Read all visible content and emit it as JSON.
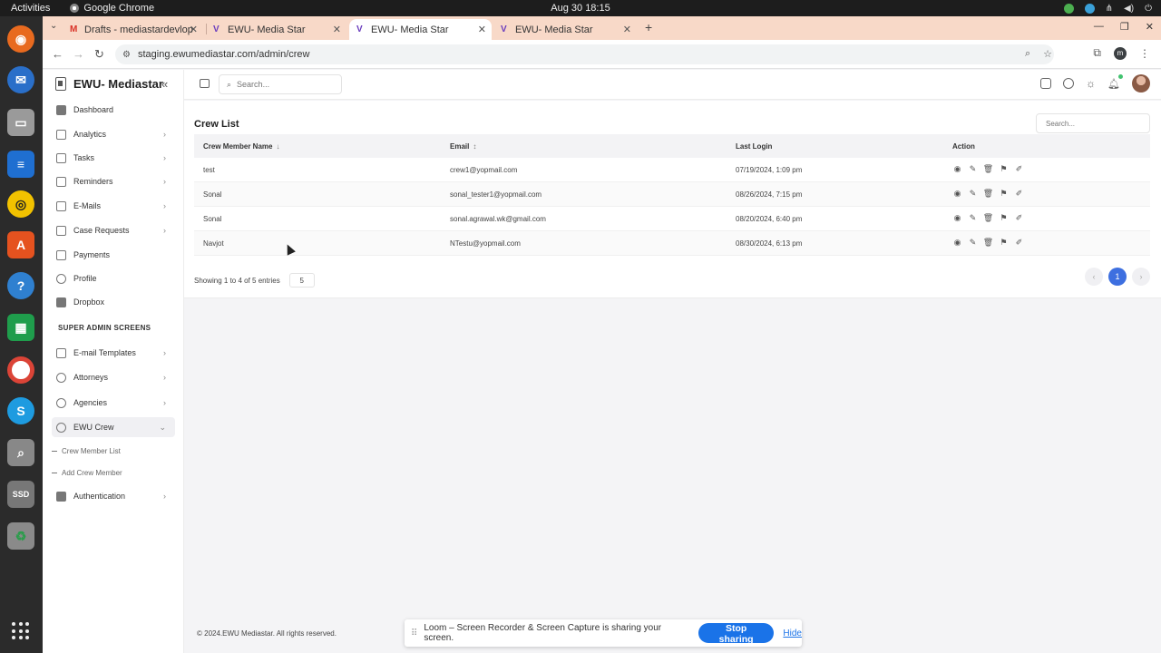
{
  "os": {
    "activities": "Activities",
    "app_name": "Google Chrome",
    "clock": "Aug 30  18:15"
  },
  "browser": {
    "tabs": [
      {
        "label": "Drafts - mediastardevlop",
        "favicon": "gmail-icon"
      },
      {
        "label": "EWU- Media Star",
        "favicon": "vite-icon"
      },
      {
        "label": "EWU- Media Star",
        "favicon": "vite-icon"
      },
      {
        "label": "EWU- Media Star",
        "favicon": "vite-icon"
      }
    ],
    "active_tab": 2,
    "url": "staging.ewumediastar.com/admin/crew",
    "profile_initial": "m"
  },
  "sidebar": {
    "brand": "EWU- Mediastar",
    "items": [
      {
        "label": "Dashboard"
      },
      {
        "label": "Analytics"
      },
      {
        "label": "Tasks"
      },
      {
        "label": "Reminders"
      },
      {
        "label": "E-Mails"
      },
      {
        "label": "Case Requests"
      },
      {
        "label": "Payments"
      },
      {
        "label": "Profile"
      },
      {
        "label": "Dropbox"
      }
    ],
    "section_header": "SUPER ADMIN SCREENS",
    "admin_items": [
      {
        "label": "E-mail Templates"
      },
      {
        "label": "Attorneys"
      },
      {
        "label": "Agencies"
      },
      {
        "label": "EWU Crew"
      }
    ],
    "sub_items": [
      {
        "label": "Crew Member List"
      },
      {
        "label": "Add Crew Member"
      }
    ],
    "auth_item": {
      "label": "Authentication"
    }
  },
  "header": {
    "search_placeholder": "Search..."
  },
  "content": {
    "title": "Crew List",
    "table_search_placeholder": "Search...",
    "columns": [
      "Crew Member Name",
      "Email",
      "Last Login",
      "Action"
    ],
    "rows": [
      {
        "name": "test",
        "email": "crew1@yopmail.com",
        "last_login": "07/19/2024, 1:09 pm"
      },
      {
        "name": "Sonal",
        "email": "sonal_tester1@yopmail.com",
        "last_login": "08/26/2024, 7:15 pm"
      },
      {
        "name": "Sonal",
        "email": "sonal.agrawal.wk@gmail.com",
        "last_login": "08/20/2024, 6:40 pm"
      },
      {
        "name": "Navjot",
        "email": "NTestu@yopmail.com",
        "last_login": "08/30/2024, 6:13 pm"
      }
    ],
    "showing_text": "Showing 1 to 4 of 5 entries",
    "page_size": "5",
    "current_page": "1",
    "copyright": "© 2024.EWU Mediastar. All rights reserved."
  },
  "loom": {
    "message": "Loom – Screen Recorder & Screen Capture is sharing your screen.",
    "stop_label": "Stop sharing",
    "hide_label": "Hide"
  },
  "colors": {
    "accent": "#3d6fe0",
    "loom_blue": "#1a73e8",
    "tabstrip": "#f8d9c8"
  }
}
